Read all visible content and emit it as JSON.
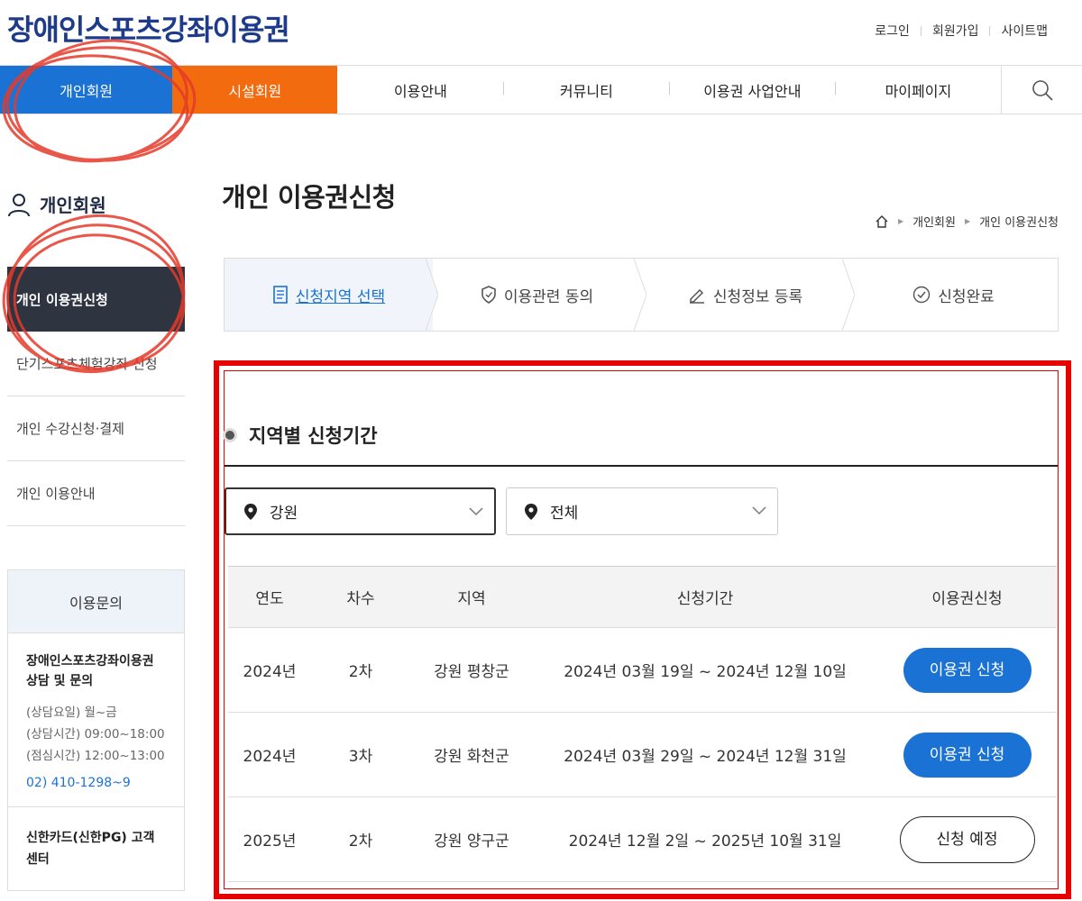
{
  "header": {
    "site_title": "장애인스포츠강좌이용권",
    "util_links": [
      "로그인",
      "회원가입",
      "사이트맵"
    ]
  },
  "gnb": {
    "member_label": "개인회원",
    "facility_label": "시설회원",
    "menu": [
      "이용안내",
      "커뮤니티",
      "이용권 사업안내",
      "마이페이지"
    ]
  },
  "sidebar": {
    "title": "개인회원",
    "items": [
      {
        "label": "개인 이용권신청",
        "active": true
      },
      {
        "label": "단기스포츠체험강좌 신청",
        "active": false
      },
      {
        "label": "개인 수강신청·결제",
        "active": false
      },
      {
        "label": "개인 이용안내",
        "active": false
      }
    ],
    "inquiry": {
      "title": "이용문의",
      "org": "장애인스포츠강좌이용권 상담 및 문의",
      "days": "(상담요일) 월~금",
      "hours": "(상담시간) 09:00~18:00",
      "lunch": "(점심시간) 12:00~13:00",
      "tel": "02) 410-1298~9",
      "card_center": "신한카드(신한PG) 고객센터"
    }
  },
  "main": {
    "page_title": "개인 이용권신청",
    "breadcrumb": [
      "개인회원",
      "개인 이용권신청"
    ],
    "steps": [
      "신청지역 선택",
      "이용관련 동의",
      "신청정보 등록",
      "신청완료"
    ],
    "active_step": 0,
    "section_title": "지역별 신청기간",
    "filters": {
      "region": "강원",
      "district": "전체"
    },
    "table": {
      "headers": [
        "연도",
        "차수",
        "지역",
        "신청기간",
        "이용권신청"
      ],
      "rows": [
        {
          "year": "2024년",
          "round": "2차",
          "region": "강원 평창군",
          "period": "2024년 03월 19일 ~ 2024년 12월 10일",
          "action": "이용권 신청",
          "status": "open"
        },
        {
          "year": "2024년",
          "round": "3차",
          "region": "강원 화천군",
          "period": "2024년 03월 29일 ~ 2024년 12월 31일",
          "action": "이용권 신청",
          "status": "open"
        },
        {
          "year": "2025년",
          "round": "2차",
          "region": "강원 양구군",
          "period": "2024년 12월 2일 ~ 2025년 10월 31일",
          "action": "신청 예정",
          "status": "upcoming"
        }
      ]
    }
  },
  "colors": {
    "brand_blue": "#1a73d4",
    "brand_orange": "#f26b0f",
    "sidebar_dark": "#2e3440",
    "annotation_red": "#e60000"
  }
}
